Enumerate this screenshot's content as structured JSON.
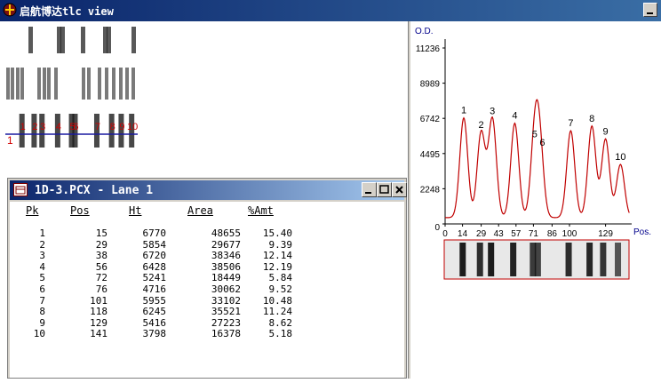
{
  "app": {
    "title": "启航博达tlc view"
  },
  "dialog": {
    "title": "1D-3.PCX - Lane 1",
    "columns": [
      "Pk",
      "Pos",
      "Ht",
      "Area",
      "%Amt"
    ],
    "rows": [
      {
        "pk": "1",
        "pos": "15",
        "ht": "6770",
        "area": "48655",
        "amt": "15.40"
      },
      {
        "pk": "2",
        "pos": "29",
        "ht": "5854",
        "area": "29677",
        "amt": "9.39"
      },
      {
        "pk": "3",
        "pos": "38",
        "ht": "6720",
        "area": "38346",
        "amt": "12.14"
      },
      {
        "pk": "4",
        "pos": "56",
        "ht": "6428",
        "area": "38506",
        "amt": "12.19"
      },
      {
        "pk": "5",
        "pos": "72",
        "ht": "5241",
        "area": "18449",
        "amt": "5.84"
      },
      {
        "pk": "6",
        "pos": "76",
        "ht": "4716",
        "area": "30062",
        "amt": "9.52"
      },
      {
        "pk": "7",
        "pos": "101",
        "ht": "5955",
        "area": "33102",
        "amt": "10.48"
      },
      {
        "pk": "8",
        "pos": "118",
        "ht": "6245",
        "area": "35521",
        "amt": "11.24"
      },
      {
        "pk": "9",
        "pos": "129",
        "ht": "5416",
        "area": "27223",
        "amt": "8.62"
      },
      {
        "pk": "10",
        "pos": "141",
        "ht": "3798",
        "area": "16378",
        "amt": "5.18"
      }
    ]
  },
  "gel": {
    "lane_marker": "1",
    "peak_labels": [
      "1",
      "2",
      "3",
      "4",
      "5",
      "6",
      "7",
      "8",
      "9",
      "10"
    ]
  },
  "chart_data": {
    "type": "line",
    "ylabel": "O.D.",
    "xlabel": "Pos.",
    "yticks": [
      0,
      2248,
      4495,
      6742,
      8989,
      11236
    ],
    "xticks": [
      0,
      14,
      29,
      43,
      57,
      71,
      86,
      100,
      129
    ],
    "xlim": [
      0,
      150
    ],
    "ylim": [
      0,
      11236
    ],
    "color": "#c00000",
    "peaks": [
      {
        "label": "1",
        "pos": 15,
        "ht": 6770
      },
      {
        "label": "2",
        "pos": 29,
        "ht": 5854
      },
      {
        "label": "3",
        "pos": 38,
        "ht": 6720
      },
      {
        "label": "4",
        "pos": 56,
        "ht": 6428
      },
      {
        "label": "5",
        "pos": 72,
        "ht": 5241
      },
      {
        "label": "6",
        "pos": 76,
        "ht": 4716
      },
      {
        "label": "7",
        "pos": 101,
        "ht": 5955
      },
      {
        "label": "8",
        "pos": 118,
        "ht": 6245
      },
      {
        "label": "9",
        "pos": 129,
        "ht": 5416
      },
      {
        "label": "10",
        "pos": 141,
        "ht": 3798
      }
    ],
    "baseline": 400
  }
}
